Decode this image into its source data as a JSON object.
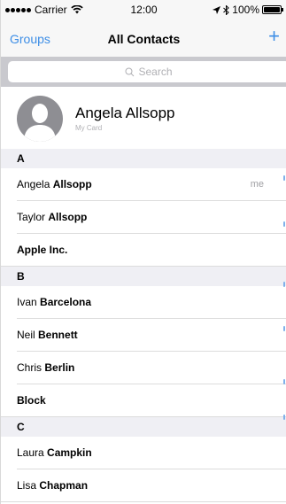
{
  "status_bar": {
    "carrier": "Carrier",
    "time": "12:00",
    "battery": "100%",
    "battery_level": 1.0
  },
  "nav": {
    "left_label": "Groups",
    "title": "All Contacts",
    "add_label": "+"
  },
  "search": {
    "placeholder": "Search"
  },
  "my_card": {
    "name": "Angela Allsopp",
    "subtitle": "My Card"
  },
  "sections": [
    {
      "header": "A",
      "rows": [
        {
          "first": "Angela",
          "last": "Allsopp",
          "tag": "me"
        },
        {
          "first": "Taylor",
          "last": "Allsopp",
          "tag": ""
        },
        {
          "first": "",
          "last": "Apple Inc.",
          "tag": ""
        }
      ]
    },
    {
      "header": "B",
      "rows": [
        {
          "first": "Ivan",
          "last": "Barcelona",
          "tag": ""
        },
        {
          "first": "Neil",
          "last": "Bennett",
          "tag": ""
        },
        {
          "first": "Chris",
          "last": "Berlin",
          "tag": ""
        },
        {
          "first": "",
          "last": "Block",
          "tag": ""
        }
      ]
    },
    {
      "header": "C",
      "rows": [
        {
          "first": "Laura",
          "last": "Campkin",
          "tag": ""
        },
        {
          "first": "Lisa",
          "last": "Chapman",
          "tag": ""
        }
      ]
    }
  ],
  "colors": {
    "accent": "#3d8ee6",
    "section_bg": "#efeff4",
    "bar_bg": "#f7f7f7",
    "search_bg": "#c9c9ce"
  }
}
